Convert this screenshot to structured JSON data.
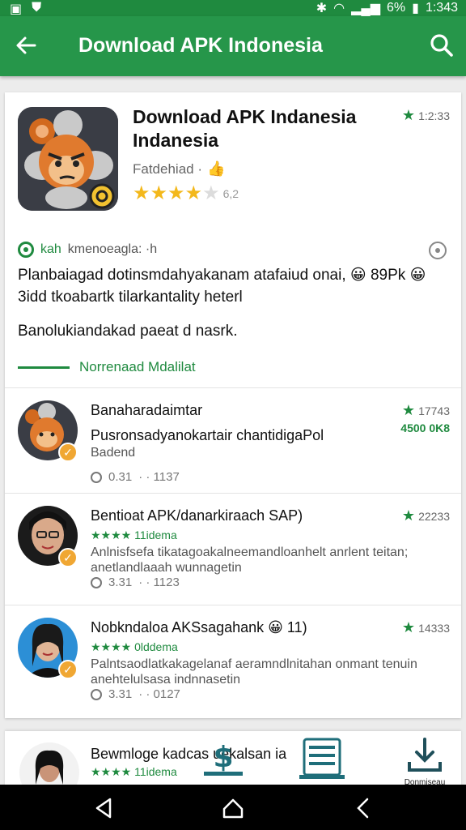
{
  "status_bar": {
    "battery": "6%",
    "time": "1:343"
  },
  "app_bar": {
    "title": "Download APK Indonesia"
  },
  "hero": {
    "title": "Download APK Indanesia Indanesia",
    "rating": "1:2:33",
    "developer": "Fatdehiad ·",
    "stars_count": "6,2",
    "stars_filled": 3.5
  },
  "section": {
    "kah": "kah",
    "header_rest": "kmenoeagla: ·h",
    "description": "Planbaiagad dotinsmdahyakanam atafaiud onai, 😀 89Pk 😀 3idd tkoabartk tilarkantality heterl",
    "note": "Banolukiandakad paeat d nasrk.",
    "more_link": "Norrenaad Mdalilat"
  },
  "items": [
    {
      "name": "Banaharadaimtar",
      "rating": "17743",
      "green_label": "4500 0K8",
      "body": "Pusronsadyanokartair chantidigaPol",
      "body2": "Badend",
      "time": "0.31",
      "date": "· · 1137",
      "avatar_color": "#3a3d45"
    },
    {
      "name": "Bentioat APK/danarkiraach SAP)",
      "rating": "22233",
      "sub": "★★★★ 11idema",
      "body": "Anlnisfsefa tikatagoakalneemandloanhelt anrlent teitan; anetlandlaaah wunnagetin",
      "time": "3.31",
      "date": "· · 1123",
      "avatar_color": "#d9a98a"
    },
    {
      "name": "Nobkndaloa AKSsagahank 😀 11)",
      "rating": "14333",
      "sub": "★★★★ 0lddema",
      "body": "Palntsaodlatkakagelanaf aeramndlnitahan onmant tenuin anehtelulsasa indnnasetin",
      "time": "3.31",
      "date": "· · 0127",
      "avatar_color": "#2c8fd6"
    }
  ],
  "bottom": {
    "name": "Bewmloge kadcas uekalsan ia",
    "sub": "★★★★ 11idema",
    "tab_label": "Donmiseau"
  }
}
